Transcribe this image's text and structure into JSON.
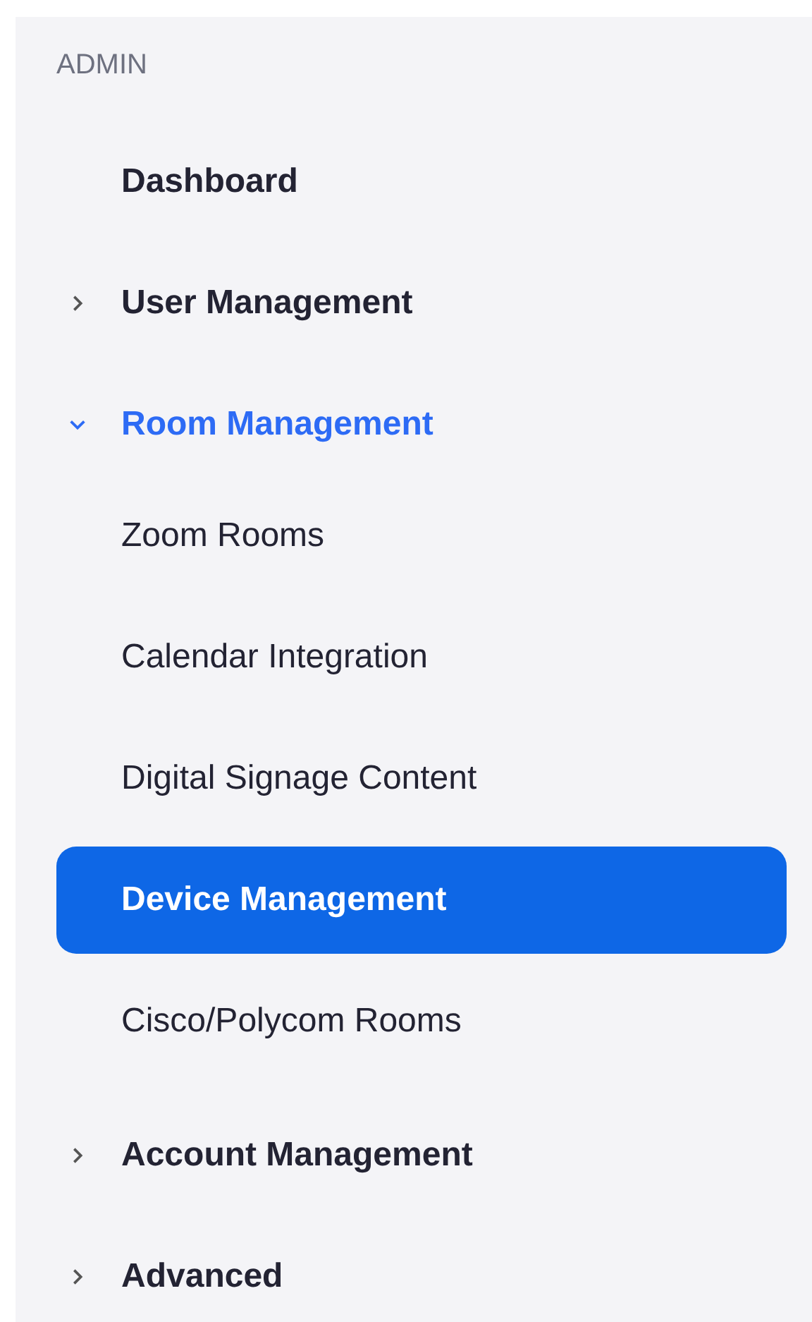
{
  "sidebar": {
    "heading": "ADMIN",
    "items": [
      {
        "label": "Dashboard",
        "kind": "link",
        "selected": false
      },
      {
        "label": "User Management",
        "kind": "group",
        "expanded": false,
        "selected": false
      },
      {
        "label": "Room Management",
        "kind": "group",
        "expanded": true,
        "selected": false,
        "children": [
          {
            "label": "Zoom Rooms",
            "selected": false
          },
          {
            "label": "Calendar Integration",
            "selected": false
          },
          {
            "label": "Digital Signage Content",
            "selected": false
          },
          {
            "label": "Device Management",
            "selected": true
          },
          {
            "label": "Cisco/Polycom Rooms",
            "selected": false
          }
        ]
      },
      {
        "label": "Account Management",
        "kind": "group",
        "expanded": false,
        "selected": false
      },
      {
        "label": "Advanced",
        "kind": "group",
        "expanded": false,
        "selected": false
      }
    ]
  }
}
